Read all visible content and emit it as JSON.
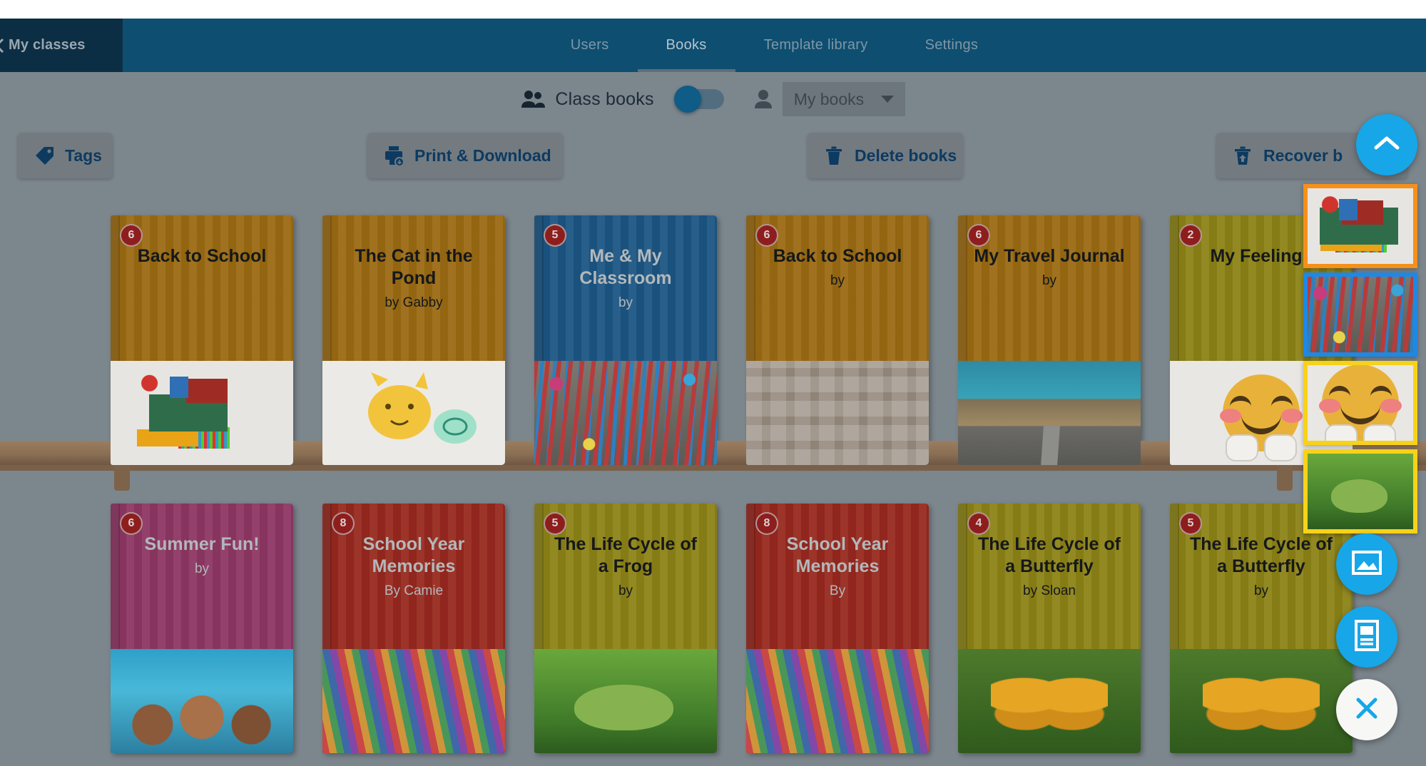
{
  "header": {
    "back_icon": "chevron-left-icon",
    "my_classes_label": "My classes",
    "tabs": [
      {
        "label": "Users",
        "active": false
      },
      {
        "label": "Books",
        "active": true
      },
      {
        "label": "Template library",
        "active": false
      },
      {
        "label": "Settings",
        "active": false
      }
    ]
  },
  "scope_row": {
    "people_icon": "people-icon",
    "class_books_label": "Class books",
    "toggle_state": "left",
    "person_icon": "person-icon",
    "my_books_selected": "My books",
    "caret_icon": "chevron-down-icon"
  },
  "toolbar": {
    "tags_label": "Tags",
    "tags_icon": "tag-icon",
    "print_label": "Print & Download",
    "print_icon": "print-download-icon",
    "delete_label": "Delete books",
    "delete_icon": "trash-icon",
    "recover_label": "Recover b",
    "recover_icon": "trash-restore-icon"
  },
  "shelves": [
    {
      "books": [
        {
          "pages": "6",
          "title": "Back to School",
          "author": "",
          "cover": "#9a6a12",
          "title_color": "dark",
          "art": "clipart"
        },
        {
          "pages": "",
          "title": "The Cat in the Pond",
          "author": "by Gabby",
          "cover": "#9a6a12",
          "title_color": "dark",
          "art": "cat"
        },
        {
          "pages": "5",
          "title": "Me & My Classroom",
          "author": "by",
          "cover": "#1b5583",
          "title_color": "light",
          "art": "art-supplies"
        },
        {
          "pages": "6",
          "title": "Back to School",
          "author": "by",
          "cover": "#9a6a12",
          "title_color": "dark",
          "art": "scrabble"
        },
        {
          "pages": "6",
          "title": "My Travel Journal",
          "author": "by",
          "cover": "#9a6a12",
          "title_color": "dark",
          "art": "desert-road"
        },
        {
          "pages": "2",
          "title": "My Feelings",
          "author": "",
          "cover": "#8c8216",
          "title_color": "dark",
          "art": "emoji-hug"
        }
      ]
    },
    {
      "books": [
        {
          "pages": "6",
          "title": "Summer Fun!",
          "author": "by",
          "cover": "#8d3663",
          "title_color": "light",
          "art": "beach-kids"
        },
        {
          "pages": "8",
          "title": "School Year Memories",
          "author": "By Camie",
          "cover": "#96281e",
          "title_color": "light",
          "art": "yarn"
        },
        {
          "pages": "5",
          "title": "The Life Cycle of a Frog",
          "author": "by",
          "cover": "#8c8216",
          "title_color": "dark",
          "art": "frog"
        },
        {
          "pages": "8",
          "title": "School Year Memories",
          "author": "By",
          "cover": "#96281e",
          "title_color": "light",
          "art": "yarn"
        },
        {
          "pages": "4",
          "title": "The Life Cycle of a Butterfly",
          "author": "by Sloan",
          "cover": "#8c8216",
          "title_color": "dark",
          "art": "butterfly"
        },
        {
          "pages": "5",
          "title": "The Life Cycle of a Butterfly",
          "author": "by",
          "cover": "#8c8216",
          "title_color": "dark",
          "art": "butterfly"
        }
      ]
    }
  ],
  "right_rail": {
    "scroll_up_icon": "chevron-up-icon",
    "thumbnails": [
      {
        "name": "school-supplies-clipart-thumbnail",
        "border": "#f5901a",
        "art": "clipart"
      },
      {
        "name": "art-supplies-photo-thumbnail",
        "border": "#1e88e5",
        "art": "art-supplies"
      },
      {
        "name": "smiling-emoji-thumbnail",
        "border": "#f7d21a",
        "art": "emoji-hug"
      },
      {
        "name": "frog-photo-thumbnail",
        "border": "#f7d21a",
        "art": "frog"
      }
    ],
    "fabs": [
      {
        "name": "add-image-fab",
        "icon": "image-icon",
        "color": "#17a6e8"
      },
      {
        "name": "add-article-fab",
        "icon": "article-icon",
        "color": "#17a6e8"
      },
      {
        "name": "close-fab",
        "icon": "close-icon",
        "color": "#f7f7f5"
      }
    ]
  }
}
